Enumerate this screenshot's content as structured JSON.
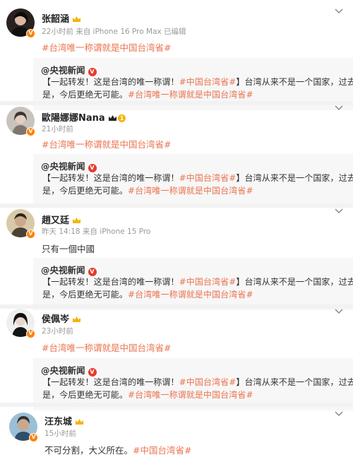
{
  "repost_source": {
    "author": "@央视新闻",
    "line1_a": "【一起转发！这是台湾的唯一称谓！",
    "line1_tag": "#中国台湾省#",
    "line1_b": "】台湾从来不是一个国家，过去不",
    "line2_a": "是，今后更绝无可能。",
    "line2_tag": "#台湾唯一称谓就是中国台湾省#"
  },
  "posts": [
    {
      "name": "张韶涵",
      "meta": "22小时前  来自 iPhone 16 Pro Max 已编辑",
      "text": "#台湾唯一称谓就是中国台湾省#",
      "avatar_icon": "avatar-dark-portrait"
    },
    {
      "name": "歐陽娜娜Nana",
      "level": "1",
      "meta": "21小时前",
      "text": "#台湾唯一称谓就是中国台湾省#",
      "avatar_icon": "avatar-portrait"
    },
    {
      "name": "趙又廷",
      "meta": "昨天 14:18  来自 iPhone 15 Pro",
      "text": "只有一個中國",
      "avatar_icon": "avatar-portrait"
    },
    {
      "name": "侯佩岑",
      "meta": "23小时前",
      "text": "#台湾唯一称谓就是中国台湾省#",
      "avatar_icon": "avatar-portrait"
    },
    {
      "name": "汪东城",
      "meta": "15小时前",
      "text_a": "不可分割，大义所在。",
      "text_tag": "#中国台湾省#",
      "avatar_icon": "avatar-portrait"
    }
  ],
  "colors": {
    "hashtag": "#eb7350",
    "verified_badge": "#ff8200",
    "media_badge": "#e63a2e",
    "repost_bg": "#f7f7f7"
  }
}
